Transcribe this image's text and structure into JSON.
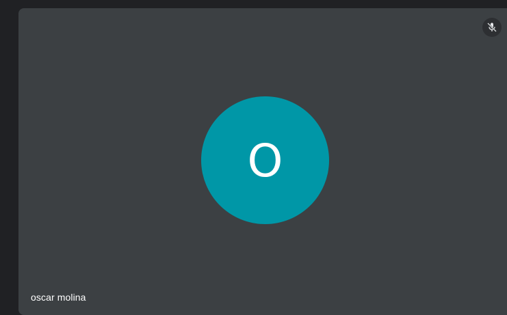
{
  "participant": {
    "name": "oscar molina",
    "initial": "O",
    "avatar_color": "#0097a7",
    "mic_icon": "mic-off-icon",
    "muted": true
  },
  "colors": {
    "page_background": "#202124",
    "tile_background": "#3c4043"
  }
}
